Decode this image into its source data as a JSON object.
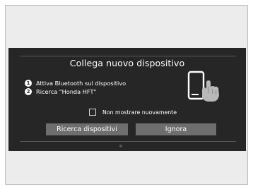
{
  "dialog": {
    "title": "Collega nuovo dispositivo",
    "steps": [
      {
        "number": "1",
        "text": "Attiva Bluetooth sul dispositivo"
      },
      {
        "number": "2",
        "text": "Ricerca \"Honda HFT\""
      }
    ],
    "illustration_icon": "phone-touch-icon",
    "checkbox": {
      "label": "Non mostrare nuovamente",
      "checked": false
    },
    "buttons": {
      "search": "Ricerca dispositivi",
      "ignore": "Ignora"
    }
  },
  "colors": {
    "screen_background": "#262626",
    "button_background": "#6e6e6e",
    "text": "#ffffff",
    "outer_frame": "#ececec"
  }
}
